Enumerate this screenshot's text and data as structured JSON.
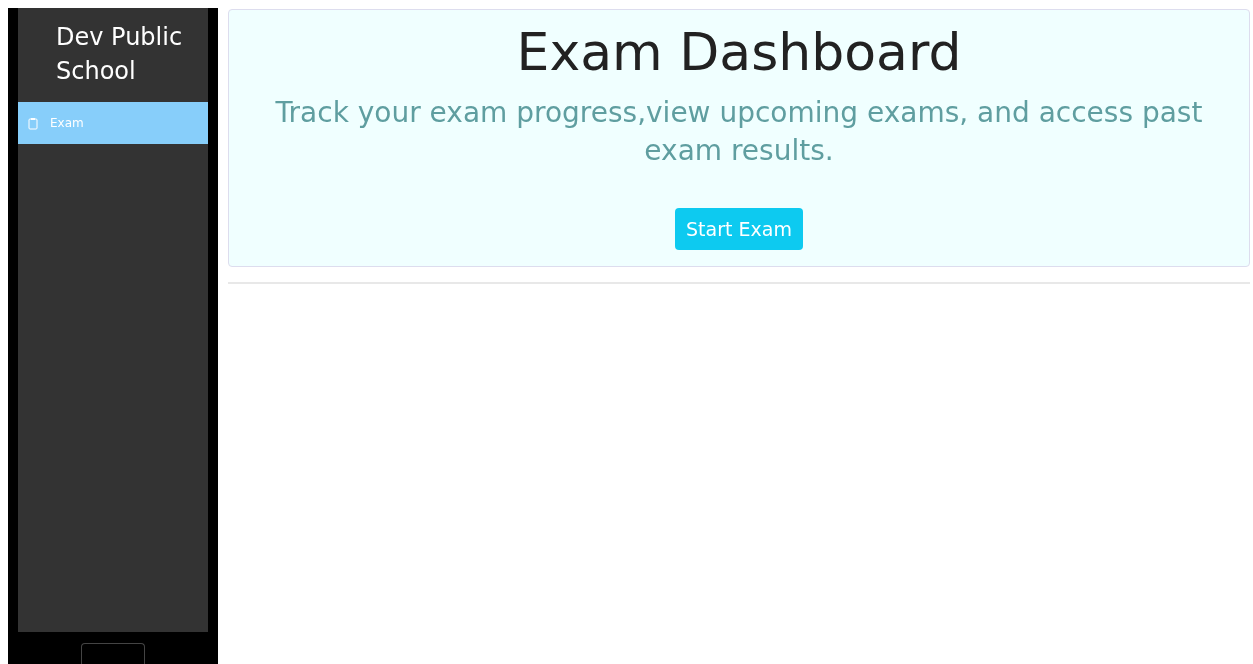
{
  "sidebar": {
    "title": "Dev Public School",
    "items": [
      {
        "label": "Exam",
        "selected": true
      }
    ]
  },
  "header": {
    "title": "Exam Dashboard",
    "subtitle": "Track your exam progress,view upcoming exams, and access past exam results.",
    "button": "Start Exam"
  }
}
